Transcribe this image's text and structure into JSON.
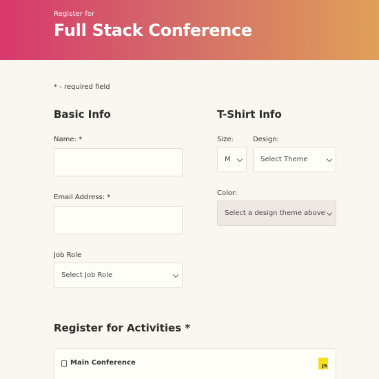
{
  "header": {
    "pretitle": "Register for",
    "title": "Full Stack Conference"
  },
  "required_note": "* - required field",
  "basic_info": {
    "title": "Basic Info",
    "name_label": "Name: *",
    "email_label": "Email Address: *",
    "job_role_label": "Job Role",
    "job_role_value": "Select Job Role"
  },
  "tshirt_info": {
    "title": "T-Shirt Info",
    "size_label": "Size:",
    "size_value": "M",
    "design_label": "Design:",
    "design_value": "Select Theme",
    "color_label": "Color:",
    "color_value": "Select a design theme above"
  },
  "activities": {
    "title": "Register for Activities *",
    "items": [
      {
        "label": "Main Conference",
        "icon": "js-icon",
        "icon_text": "JS"
      }
    ]
  }
}
